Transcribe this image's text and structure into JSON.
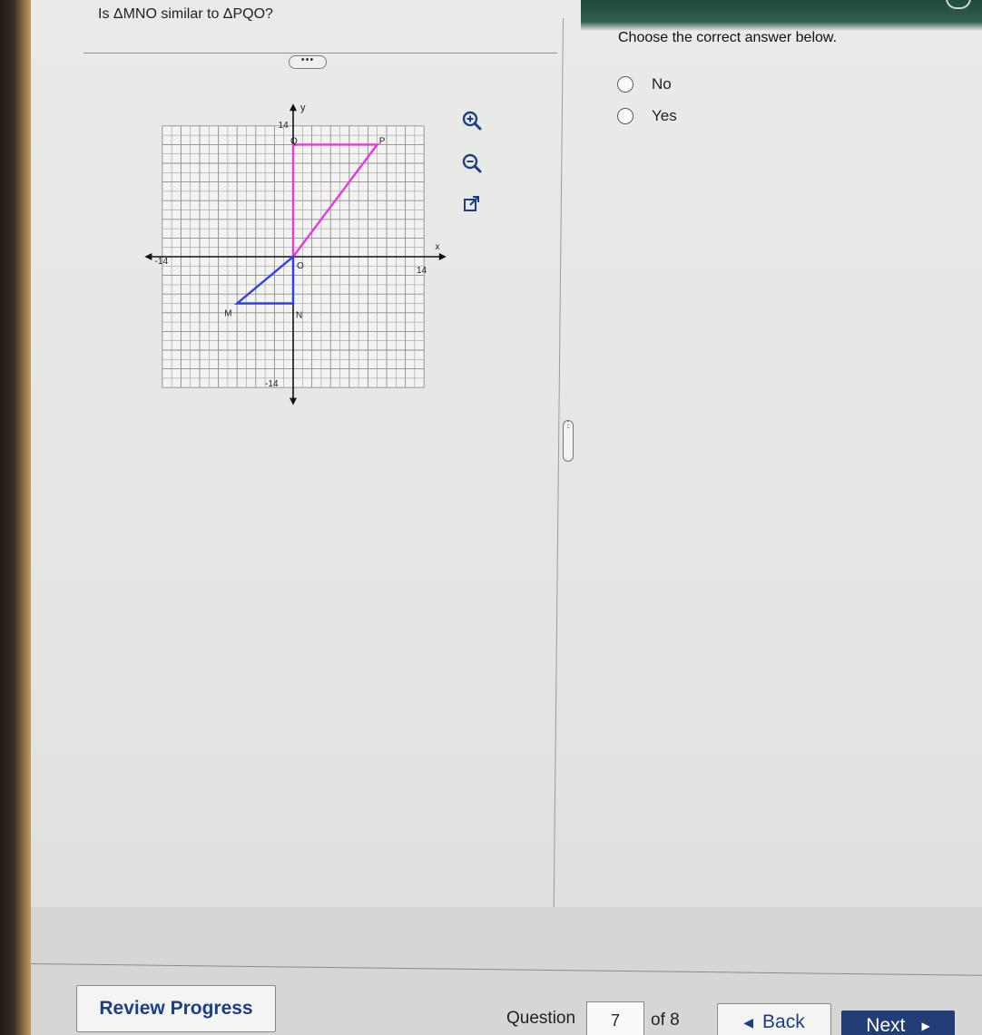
{
  "question": {
    "text": "Is ΔMNO similar to ΔPQO?"
  },
  "toolbar": {
    "more_label": "•••",
    "zoom_in": "zoom-in-icon",
    "zoom_out": "zoom-out-icon",
    "popout": "external-link-icon"
  },
  "graph": {
    "axis_x_label": "x",
    "axis_y_label": "y",
    "x_min_label": "-14",
    "x_max_label": "14",
    "y_max_label": "14",
    "y_min_label": "-14",
    "points": {
      "M": {
        "label": "M",
        "x": -6,
        "y": -5
      },
      "N": {
        "label": "N",
        "x": 0,
        "y": -5
      },
      "O": {
        "label": "O",
        "x": 0,
        "y": 0
      },
      "P": {
        "label": "P",
        "x": 9,
        "y": 12
      },
      "Q": {
        "label": "Q",
        "x": 0,
        "y": 12
      }
    },
    "colors": {
      "mno": "#2f3ee6",
      "pqo": "#e63ae0",
      "grid": "#8d8f8d",
      "axis": "#111111"
    }
  },
  "answer_panel": {
    "prompt": "Choose the correct answer below.",
    "choices": [
      {
        "label": "No"
      },
      {
        "label": "Yes"
      }
    ]
  },
  "footer": {
    "review_label": "Review Progress",
    "question_label": "Question",
    "question_number": "7",
    "of_label": "of 8",
    "back_label": "Back",
    "next_label": "Next"
  }
}
